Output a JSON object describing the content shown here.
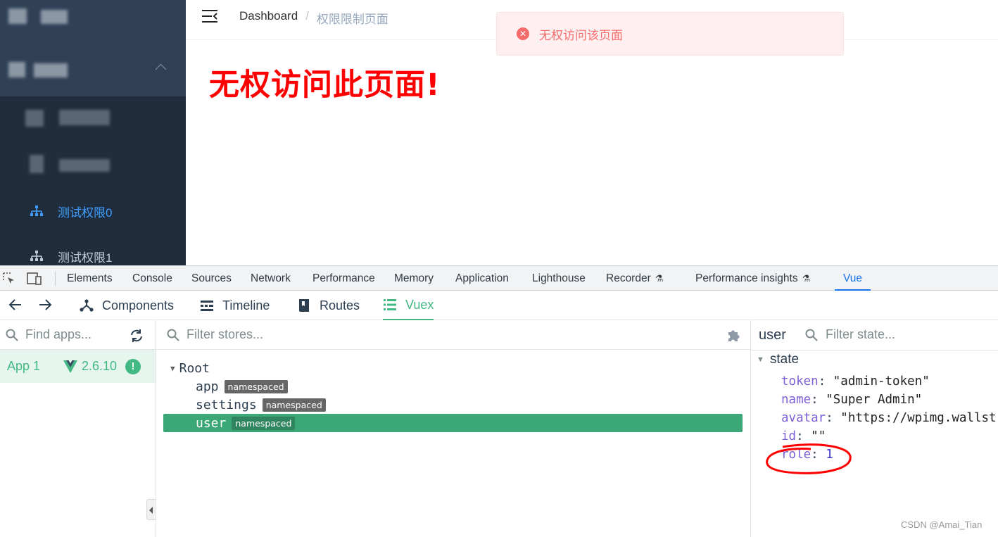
{
  "sidebar": {
    "items": [
      {
        "label": "测试权限0",
        "active": true,
        "icon": "sitemap-icon"
      },
      {
        "label": "测试权限1",
        "active": false,
        "icon": "sitemap-icon"
      }
    ]
  },
  "navbar": {
    "breadcrumb": [
      "Dashboard",
      "/",
      "权限限制页面"
    ]
  },
  "toast": {
    "message": "无权访问该页面",
    "icon": "close-circle-icon"
  },
  "main": {
    "title": "无权访问此页面!"
  },
  "devtools": {
    "tabs": [
      "Elements",
      "Console",
      "Sources",
      "Network",
      "Performance",
      "Memory",
      "Application",
      "Lighthouse",
      "Recorder",
      "Performance insights",
      "Vue"
    ],
    "active_tab": "Vue"
  },
  "vue": {
    "nav_tabs": [
      "Components",
      "Timeline",
      "Routes",
      "Vuex"
    ],
    "active_nav": "Vuex",
    "apps_search_placeholder": "Find apps...",
    "app": {
      "name": "App 1",
      "version": "2.6.10"
    },
    "stores_search_placeholder": "Filter stores...",
    "stores": {
      "root": "Root",
      "modules": [
        {
          "name": "app",
          "badge": "namespaced"
        },
        {
          "name": "settings",
          "badge": "namespaced"
        },
        {
          "name": "user",
          "badge": "namespaced"
        }
      ],
      "selected": "user"
    },
    "state_panel": {
      "store_name": "user",
      "search_placeholder": "Filter state...",
      "section": "state",
      "entries": [
        {
          "key": "token",
          "value": "\"admin-token\""
        },
        {
          "key": "name",
          "value": "\"Super Admin\""
        },
        {
          "key": "avatar",
          "value": "\"https://wpimg.wallst"
        },
        {
          "key": "id",
          "value": "\"\""
        },
        {
          "key": "role",
          "value": "1"
        }
      ]
    }
  },
  "colors": {
    "vue_green": "#42b883",
    "selected_row": "#3ba776",
    "error_red": "#f56c6c",
    "devtools_blue": "#1a73e8"
  },
  "watermark": "CSDN @Amai_Tian"
}
